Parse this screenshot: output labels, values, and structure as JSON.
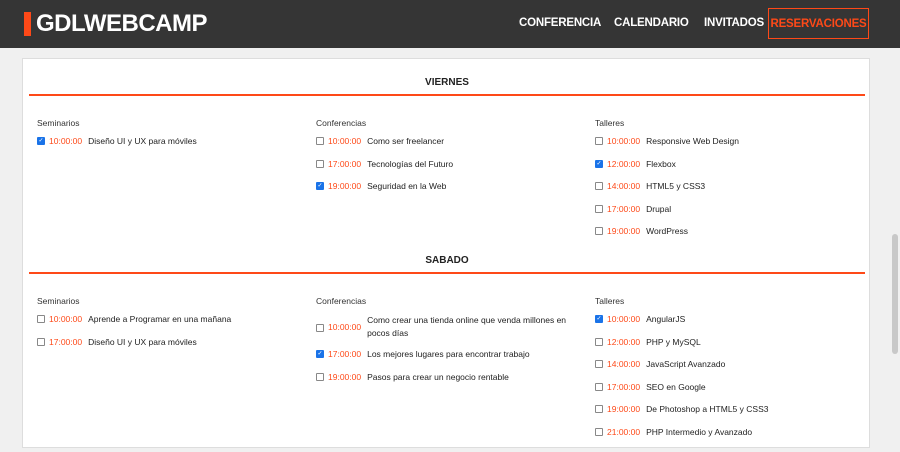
{
  "header": {
    "logo": "GDLWEBCAMP",
    "nav": [
      "CONFERENCIA",
      "CALENDARIO",
      "INVITADOS"
    ],
    "reserve": "RESERVACIONES"
  },
  "days": [
    {
      "title": "VIERNES",
      "columns": [
        {
          "title": "Seminarios",
          "items": [
            {
              "time": "10:00:00",
              "name": "Diseño UI y UX para móviles",
              "checked": true
            }
          ]
        },
        {
          "title": "Conferencias",
          "items": [
            {
              "time": "10:00:00",
              "name": "Como ser freelancer",
              "checked": false
            },
            {
              "time": "17:00:00",
              "name": "Tecnologías del Futuro",
              "checked": false
            },
            {
              "time": "19:00:00",
              "name": "Seguridad en la Web",
              "checked": true
            }
          ]
        },
        {
          "title": "Talleres",
          "items": [
            {
              "time": "10:00:00",
              "name": "Responsive Web Design",
              "checked": false
            },
            {
              "time": "12:00:00",
              "name": "Flexbox",
              "checked": true
            },
            {
              "time": "14:00:00",
              "name": "HTML5 y CSS3",
              "checked": false
            },
            {
              "time": "17:00:00",
              "name": "Drupal",
              "checked": false
            },
            {
              "time": "19:00:00",
              "name": "WordPress",
              "checked": false
            }
          ]
        }
      ]
    },
    {
      "title": "SABADO",
      "columns": [
        {
          "title": "Seminarios",
          "items": [
            {
              "time": "10:00:00",
              "name": "Aprende a Programar en una mañana",
              "checked": false
            },
            {
              "time": "17:00:00",
              "name": "Diseño UI y UX para móviles",
              "checked": false
            }
          ]
        },
        {
          "title": "Conferencias",
          "items": [
            {
              "time": "10:00:00",
              "name": "Como crear una tienda online que venda millones en pocos días",
              "checked": false
            },
            {
              "time": "17:00:00",
              "name": "Los mejores lugares para encontrar trabajo",
              "checked": true
            },
            {
              "time": "19:00:00",
              "name": "Pasos para crear un negocio rentable",
              "checked": false
            }
          ]
        },
        {
          "title": "Talleres",
          "items": [
            {
              "time": "10:00:00",
              "name": "AngularJS",
              "checked": true
            },
            {
              "time": "12:00:00",
              "name": "PHP y MySQL",
              "checked": false
            },
            {
              "time": "14:00:00",
              "name": "JavaScript Avanzado",
              "checked": false
            },
            {
              "time": "17:00:00",
              "name": "SEO en Google",
              "checked": false
            },
            {
              "time": "19:00:00",
              "name": "De Photoshop a HTML5 y CSS3",
              "checked": false
            },
            {
              "time": "21:00:00",
              "name": "PHP Intermedio y Avanzado",
              "checked": false
            }
          ]
        }
      ]
    }
  ],
  "colors": {
    "accent": "#fe4918",
    "header_bg": "#353535",
    "checkbox_on": "#1a73e8"
  }
}
